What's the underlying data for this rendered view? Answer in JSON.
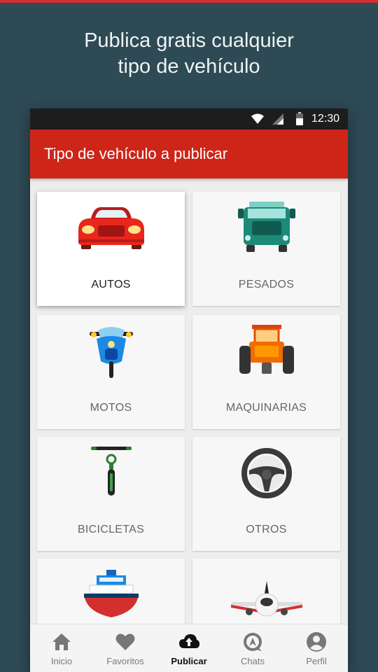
{
  "promo": {
    "line1": "Publica gratis cualquier",
    "line2": "tipo de vehículo"
  },
  "status_bar": {
    "time": "12:30",
    "icons": [
      "wifi-icon",
      "signal-icon",
      "battery-icon"
    ]
  },
  "app_bar": {
    "title": "Tipo de vehículo a publicar"
  },
  "vehicle_types": [
    {
      "label": "AUTOS",
      "icon": "car-icon",
      "selected": true
    },
    {
      "label": "PESADOS",
      "icon": "truck-icon",
      "selected": false
    },
    {
      "label": "MOTOS",
      "icon": "motorcycle-icon",
      "selected": false
    },
    {
      "label": "MAQUINARIAS",
      "icon": "tractor-icon",
      "selected": false
    },
    {
      "label": "BICICLETAS",
      "icon": "bicycle-icon",
      "selected": false
    },
    {
      "label": "OTROS",
      "icon": "steering-wheel-icon",
      "selected": false
    },
    {
      "label": "",
      "icon": "boat-icon",
      "selected": false
    },
    {
      "label": "",
      "icon": "airplane-icon",
      "selected": false
    }
  ],
  "bottom_nav": [
    {
      "label": "Inicio",
      "icon": "home-icon",
      "active": false
    },
    {
      "label": "Favoritos",
      "icon": "heart-icon",
      "active": false
    },
    {
      "label": "Publicar",
      "icon": "cloud-upload-icon",
      "active": true
    },
    {
      "label": "Chats",
      "icon": "chat-icon",
      "active": false
    },
    {
      "label": "Perfil",
      "icon": "profile-icon",
      "active": false
    }
  ],
  "colors": {
    "background": "#2e4a55",
    "app_bar": "#ce2519",
    "status_bar": "#1d1d1d",
    "active_nav": "#111111"
  }
}
